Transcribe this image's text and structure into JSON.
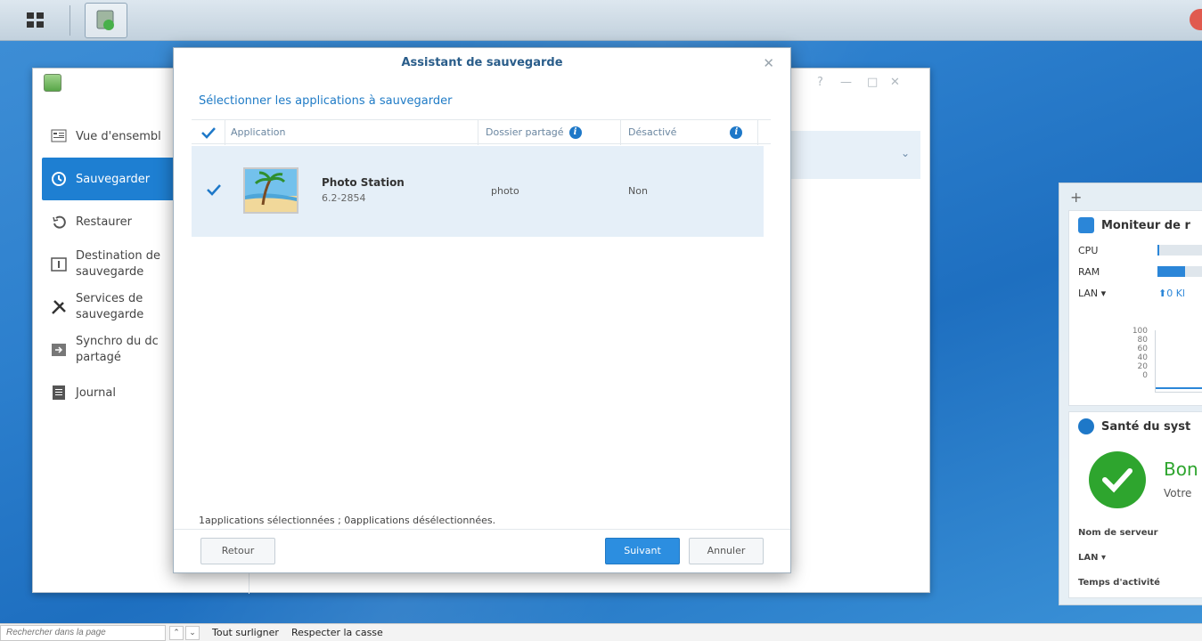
{
  "taskbar": {
    "main_menu_icon": "grid-icon",
    "active_app_icon": "backup-app-icon"
  },
  "app_window": {
    "sidebar": [
      {
        "label": "Vue d'ensembl",
        "icon": "overview-icon"
      },
      {
        "label": "Sauvegarder",
        "icon": "backup-icon",
        "active": true
      },
      {
        "label": "Restaurer",
        "icon": "restore-icon"
      },
      {
        "label": "Destination de",
        "label2": "sauvegarde",
        "icon": "destination-icon"
      },
      {
        "label": "Services de",
        "label2": "sauvegarde",
        "icon": "services-icon"
      },
      {
        "label": "Synchro du dc",
        "label2": "partagé",
        "icon": "sync-icon"
      },
      {
        "label": "Journal",
        "icon": "journal-icon"
      }
    ]
  },
  "dialog": {
    "title": "Assistant de sauvegarde",
    "subtitle": "Sélectionner les applications à sauvegarder",
    "columns": {
      "application": "Application",
      "shared_folder": "Dossier partagé",
      "disabled": "Désactivé"
    },
    "rows": [
      {
        "name": "Photo Station",
        "version": "6.2-2854",
        "shared_folder": "photo",
        "disabled": "Non",
        "checked": true
      }
    ],
    "status": "1applications sélectionnées ; 0applications désélectionnées.",
    "buttons": {
      "back": "Retour",
      "next": "Suivant",
      "cancel": "Annuler"
    }
  },
  "widgets": {
    "plus": "+",
    "monitor": {
      "title": "Moniteur de r",
      "cpu_label": "CPU",
      "cpu_level": 0.04,
      "ram_label": "RAM",
      "ram_level": 0.6,
      "lan_label": "LAN ▾",
      "lan_value": "⬆0 Kl",
      "axis": [
        "100",
        "80",
        "60",
        "40",
        "20",
        "0"
      ]
    },
    "health": {
      "title": "Santé du syst",
      "status": "Bon",
      "sub": "Votre",
      "server_name": "Nom de serveur",
      "lan": "LAN ▾",
      "uptime": "Temps d'activité"
    }
  },
  "findbar": {
    "placeholder": "Rechercher dans la page",
    "highlight_all": "Tout surligner",
    "match_case": "Respecter la casse"
  },
  "colors": {
    "accent": "#1e7fd2",
    "success": "#2ea52e",
    "title": "#2a5d8a"
  }
}
